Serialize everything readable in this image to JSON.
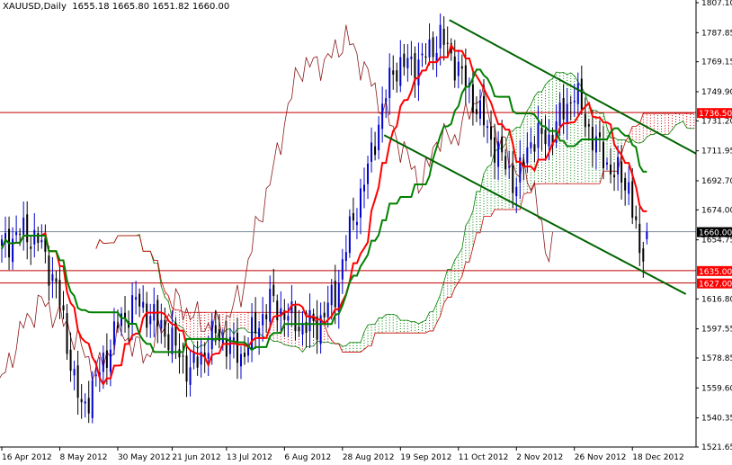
{
  "chart_data": {
    "type": "candlestick",
    "symbol": "XAUUSD",
    "timeframe": "Daily",
    "ohlc_label": {
      "open": "1655.18",
      "high": "1665.80",
      "low": "1651.82",
      "close": "1660.00"
    },
    "ylim": [
      1521.65,
      1807.1
    ],
    "y_ticks": [
      "1807.10",
      "1787.85",
      "1769.15",
      "1749.90",
      "1731.20",
      "1711.95",
      "1692.70",
      "1674.00",
      "1654.75",
      "1616.80",
      "1597.55",
      "1578.85",
      "1559.60",
      "1540.35",
      "1521.65"
    ],
    "x_ticks": [
      {
        "bar": 0,
        "label": "16 Apr 2012"
      },
      {
        "bar": 16,
        "label": "8 May 2012"
      },
      {
        "bar": 32,
        "label": "30 May 2012"
      },
      {
        "bar": 47,
        "label": "21 Jun 2012"
      },
      {
        "bar": 62,
        "label": "13 Jul 2012"
      },
      {
        "bar": 78,
        "label": "6 Aug 2012"
      },
      {
        "bar": 94,
        "label": "28 Aug 2012"
      },
      {
        "bar": 110,
        "label": "19 Sep 2012"
      },
      {
        "bar": 126,
        "label": "11 Oct 2012"
      },
      {
        "bar": 142,
        "label": "2 Nov 2012"
      },
      {
        "bar": 158,
        "label": "26 Nov 2012"
      },
      {
        "bar": 174,
        "label": "18 Dec 2012"
      }
    ],
    "close_anchors": [
      [
        0,
        1650
      ],
      [
        5,
        1660
      ],
      [
        10,
        1655
      ],
      [
        15,
        1625
      ],
      [
        20,
        1565
      ],
      [
        22,
        1545
      ],
      [
        27,
        1570
      ],
      [
        32,
        1600
      ],
      [
        37,
        1615
      ],
      [
        44,
        1600
      ],
      [
        52,
        1570
      ],
      [
        59,
        1595
      ],
      [
        66,
        1580
      ],
      [
        74,
        1615
      ],
      [
        82,
        1600
      ],
      [
        87,
        1600
      ],
      [
        92,
        1620
      ],
      [
        96,
        1660
      ],
      [
        101,
        1700
      ],
      [
        104,
        1730
      ],
      [
        108,
        1765
      ],
      [
        116,
        1770
      ],
      [
        121,
        1785
      ],
      [
        126,
        1765
      ],
      [
        131,
        1740
      ],
      [
        136,
        1715
      ],
      [
        142,
        1690
      ],
      [
        146,
        1720
      ],
      [
        151,
        1720
      ],
      [
        158,
        1750
      ],
      [
        163,
        1720
      ],
      [
        168,
        1700
      ],
      [
        173,
        1690
      ],
      [
        175,
        1660
      ],
      [
        176,
        1640
      ],
      [
        178,
        1660
      ]
    ],
    "bars_total": 179,
    "horizontal_levels": [
      {
        "price": 1736.5,
        "label": "1736.50",
        "color": "#ff0000"
      },
      {
        "price": 1660.0,
        "label": "1660.00",
        "color": "#000000"
      },
      {
        "price": 1635.0,
        "label": "1635.00",
        "color": "#ff0000"
      },
      {
        "price": 1627.0,
        "label": "1627.00",
        "color": "#ff0000"
      }
    ],
    "trend_lines": [
      {
        "from": [
          123.5,
          1796
        ],
        "to": [
          193.5,
          1707.7
        ],
        "color": "#006400"
      },
      {
        "from": [
          105.5,
          1722
        ],
        "to": [
          188.75,
          1619.9
        ],
        "color": "#006400"
      }
    ],
    "indicators": {
      "name": "Ichimoku",
      "tenkan": 9,
      "kijun": 26,
      "senkou_b": 52
    },
    "colors": {
      "up": "#0000cc",
      "down": "#000000",
      "tenkan": "#ff0000",
      "kijun": "#008000",
      "chikou": "#8b1a1a",
      "cloud_up": "#008000",
      "cloud_down": "#cc0000",
      "level_line": "#c00000",
      "price_line": "#7a8a9a"
    }
  }
}
